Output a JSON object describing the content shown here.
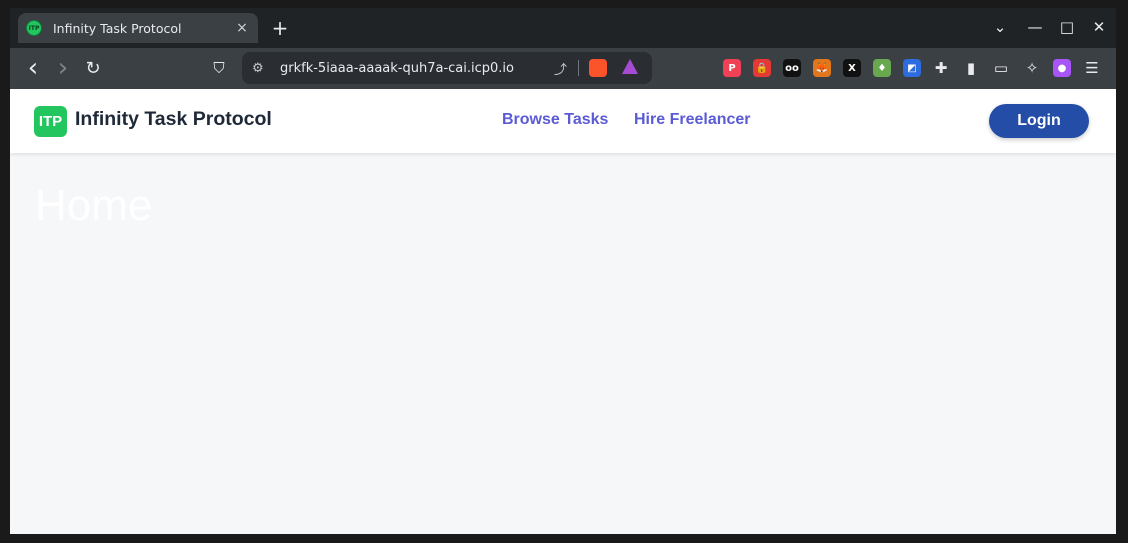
{
  "browser": {
    "tab": {
      "title": "Infinity Task Protocol",
      "favicon_text": "ITP",
      "close_icon": "×"
    },
    "new_tab_icon": "+",
    "window_controls": {
      "dropdown": "⌄",
      "minimize": "—",
      "maximize": "□",
      "close": "✕"
    },
    "nav": {
      "back": "‹",
      "forward": "›",
      "reload": "↻",
      "bookmark": "⛉"
    },
    "omnibox": {
      "url": "grkfk-5iaaa-aaaak-quh7a-cai.icp0.io",
      "site_info_icon": "⚙",
      "share_icon": "⤴"
    },
    "extensions": [
      {
        "name": "pocket-extension-icon",
        "glyph": "P",
        "color": "#ef4056"
      },
      {
        "name": "lock-extension-icon",
        "glyph": "🔒",
        "color": "#e53935"
      },
      {
        "name": "glasses-extension-icon",
        "glyph": "oo",
        "color": "#111111"
      },
      {
        "name": "metamask-fox-icon",
        "glyph": "🦊",
        "color": "#e2761b"
      },
      {
        "name": "x-extension-icon",
        "glyph": "X",
        "color": "#111111"
      },
      {
        "name": "drop-extension-icon",
        "glyph": "♦",
        "color": "#6aa84f"
      },
      {
        "name": "shield-extension-icon",
        "glyph": "◩",
        "color": "#2d6cdf"
      },
      {
        "name": "puzzle-icon",
        "glyph": "✚",
        "color": "#3b4045"
      },
      {
        "name": "sidebar-icon",
        "glyph": "▮",
        "color": "#3b4045"
      },
      {
        "name": "wallet-icon",
        "glyph": "▭",
        "color": "#3b4045"
      },
      {
        "name": "sparkle-icon",
        "glyph": "✧",
        "color": "#3b4045"
      },
      {
        "name": "profile-avatar-icon",
        "glyph": "●",
        "color": "#a855f7"
      },
      {
        "name": "menu-icon",
        "glyph": "☰",
        "color": "#3b4045"
      }
    ]
  },
  "app": {
    "logo_text": "ITP",
    "brand": "Infinity Task Protocol",
    "nav_links": [
      "Browse Tasks",
      "Hire Freelancer"
    ],
    "login_label": "Login",
    "page_title": "Home",
    "colors": {
      "accent_green": "#22c55e",
      "link_purple": "#5b5bd6",
      "login_blue": "#234da6"
    }
  }
}
